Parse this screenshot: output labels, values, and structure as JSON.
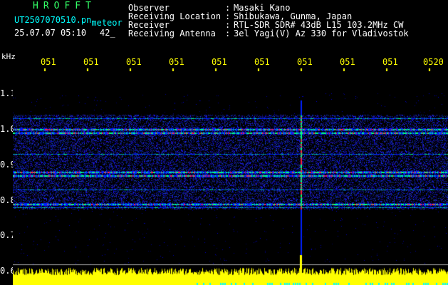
{
  "header": {
    "brand": "HROFFT",
    "filename": "UT2507070510.pn",
    "filename_suffix": "meteor",
    "datetime": "25.07.07 05:10",
    "duration": "42_",
    "info": [
      {
        "label": "Observer",
        "sep": ":",
        "value": "Masaki Kano"
      },
      {
        "label": "Receiving Location",
        "sep": ":",
        "value": "Shibukawa, Gunma, Japan"
      },
      {
        "label": "Receiver",
        "sep": ":",
        "value": "RTL-SDR SDR# 43dB L15 103.2MHz CW"
      },
      {
        "label": "Receiving Antenna",
        "sep": ":",
        "value": "3el Yagi(V) Az 330 for Vladivostok"
      }
    ]
  },
  "axis": {
    "y_unit": "kHz",
    "x_ticks": [
      "051",
      "051",
      "051",
      "051",
      "051",
      "051",
      "051",
      "051",
      "051",
      "0520"
    ],
    "y_ticks": [
      "1.1",
      "1.0",
      "0.9",
      "0.8",
      "0.7",
      "0.6"
    ]
  },
  "colors": {
    "background": "#000000",
    "info_text": "#00ffff",
    "brand_text": "#33ff66",
    "tick_text": "#ffff00",
    "level_bar": "#ffff00",
    "signal_low": "#0020ff",
    "signal_mid": "#00ff80",
    "signal_high": "#ff2040"
  },
  "signal": {
    "bands_khz": [
      1.03,
      1.0,
      0.99,
      0.93,
      0.88,
      0.87,
      0.83,
      0.79,
      0.78
    ],
    "meteor_time_fraction": 0.662,
    "level_floor_khz": 0.598
  }
}
